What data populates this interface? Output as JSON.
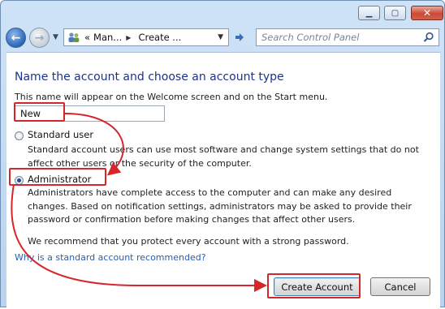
{
  "window": {
    "min_glyph": "▁",
    "max_glyph": "▢",
    "close_glyph": "✕"
  },
  "address": {
    "crumb1": "Man...",
    "crumb2": "Create ...",
    "prefix": "«"
  },
  "search": {
    "placeholder": "Search Control Panel"
  },
  "page": {
    "heading": "Name the account and choose an account type",
    "subtext": "This name will appear on the Welcome screen and on the Start menu.",
    "name_value": "New",
    "options": [
      {
        "label": "Standard user",
        "selected": false,
        "description": "Standard account users can use most software and change system settings that do not affect other users or the security of the computer."
      },
      {
        "label": "Administrator",
        "selected": true,
        "description": "Administrators have complete access to the computer and can make any desired changes. Based on notification settings, administrators may be asked to provide their password or confirmation before making changes that affect other users."
      }
    ],
    "recommendation": "We recommend that you protect every account with a strong password.",
    "help_link": "Why is a standard account recommended?"
  },
  "buttons": {
    "create": "Create Account",
    "cancel": "Cancel"
  },
  "colors": {
    "highlight": "#d7262a",
    "heading": "#1e3287",
    "link": "#2a5db0"
  },
  "icons": [
    "back-arrow-icon",
    "forward-arrow-icon",
    "users-icon",
    "refresh-icon",
    "search-icon"
  ]
}
